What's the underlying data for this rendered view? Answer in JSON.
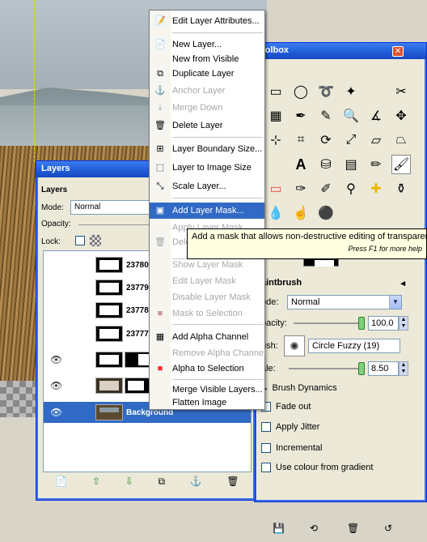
{
  "toolbox": {
    "title": "oolbox",
    "close_glyph": "✕",
    "paintbrush_label": "aintbrush",
    "mode_label": "ode:",
    "mode_value": "Normal",
    "opacity_label": "pacity:",
    "opacity_value": "100.0",
    "brush_label": "ush:",
    "brush_value": "Circle Fuzzy (19)",
    "scale_label": "ale:",
    "scale_value": "8.50",
    "options": {
      "brush_dynamics": "Brush Dynamics",
      "fade_out": "Fade out",
      "apply_jitter": "Apply Jitter",
      "incremental": "Incremental",
      "use_colour_from_gradient": "Use colour from gradient"
    }
  },
  "layers": {
    "title": "Layers",
    "panel_label": "Layers",
    "mode_label": "Mode:",
    "mode_value": "Normal",
    "opacity_label": "Opacity:",
    "lock_label": "Lock:",
    "rows": [
      {
        "name": "23780",
        "visible": false
      },
      {
        "name": "23779",
        "visible": false
      },
      {
        "name": "23778",
        "visible": false
      },
      {
        "name": "23777",
        "visible": false
      },
      {
        "name": "",
        "visible": true
      },
      {
        "name": "",
        "visible": true
      },
      {
        "name": "Background",
        "visible": true
      }
    ]
  },
  "menu": {
    "items": [
      {
        "label": "Edit Layer Attributes...",
        "icon": "edit-attributes-icon",
        "disabled": false
      },
      {
        "label": "New Layer...",
        "icon": "new-layer-icon",
        "disabled": false
      },
      {
        "label": "New from Visible",
        "icon": "",
        "disabled": false
      },
      {
        "label": "Duplicate Layer",
        "icon": "duplicate-layer-icon",
        "disabled": false
      },
      {
        "label": "Anchor Layer",
        "icon": "anchor-icon",
        "disabled": true
      },
      {
        "label": "Merge Down",
        "icon": "merge-down-icon",
        "disabled": true
      },
      {
        "label": "Delete Layer",
        "icon": "delete-icon",
        "disabled": false
      },
      {
        "label": "Layer Boundary Size...",
        "icon": "boundary-size-icon",
        "disabled": false
      },
      {
        "label": "Layer to Image Size",
        "icon": "layer-to-image-icon",
        "disabled": false
      },
      {
        "label": "Scale Layer...",
        "icon": "scale-layer-icon",
        "disabled": false
      },
      {
        "label": "Add Layer Mask...",
        "icon": "add-mask-icon",
        "disabled": false,
        "highlight": true
      },
      {
        "label": "Apply Layer Mask",
        "icon": "",
        "disabled": true
      },
      {
        "label": "Delete Layer Mask",
        "icon": "delete-mask-icon",
        "disabled": true
      },
      {
        "label": "Show Layer Mask",
        "icon": "",
        "disabled": true
      },
      {
        "label": "Edit Layer Mask",
        "icon": "",
        "disabled": true
      },
      {
        "label": "Disable Layer Mask",
        "icon": "",
        "disabled": true
      },
      {
        "label": "Mask to Selection",
        "icon": "mask-to-selection-icon",
        "disabled": true
      },
      {
        "label": "Add Alpha Channel",
        "icon": "alpha-channel-icon",
        "disabled": false
      },
      {
        "label": "Remove Alpha Channel",
        "icon": "",
        "disabled": true
      },
      {
        "label": "Alpha to Selection",
        "icon": "alpha-selection-icon",
        "disabled": false
      },
      {
        "label": "Merge Visible Layers...",
        "icon": "",
        "disabled": false
      },
      {
        "label": "Flatten Image",
        "icon": "",
        "disabled": false
      }
    ]
  },
  "tooltip": {
    "text": "Add a mask that allows non-destructive editing of transparency",
    "hint": "Press F1 for more help"
  },
  "colors": {
    "selection": "#316ac5",
    "title_bar": "#1f5bd6",
    "tooltip_bg": "#ffffe1"
  }
}
